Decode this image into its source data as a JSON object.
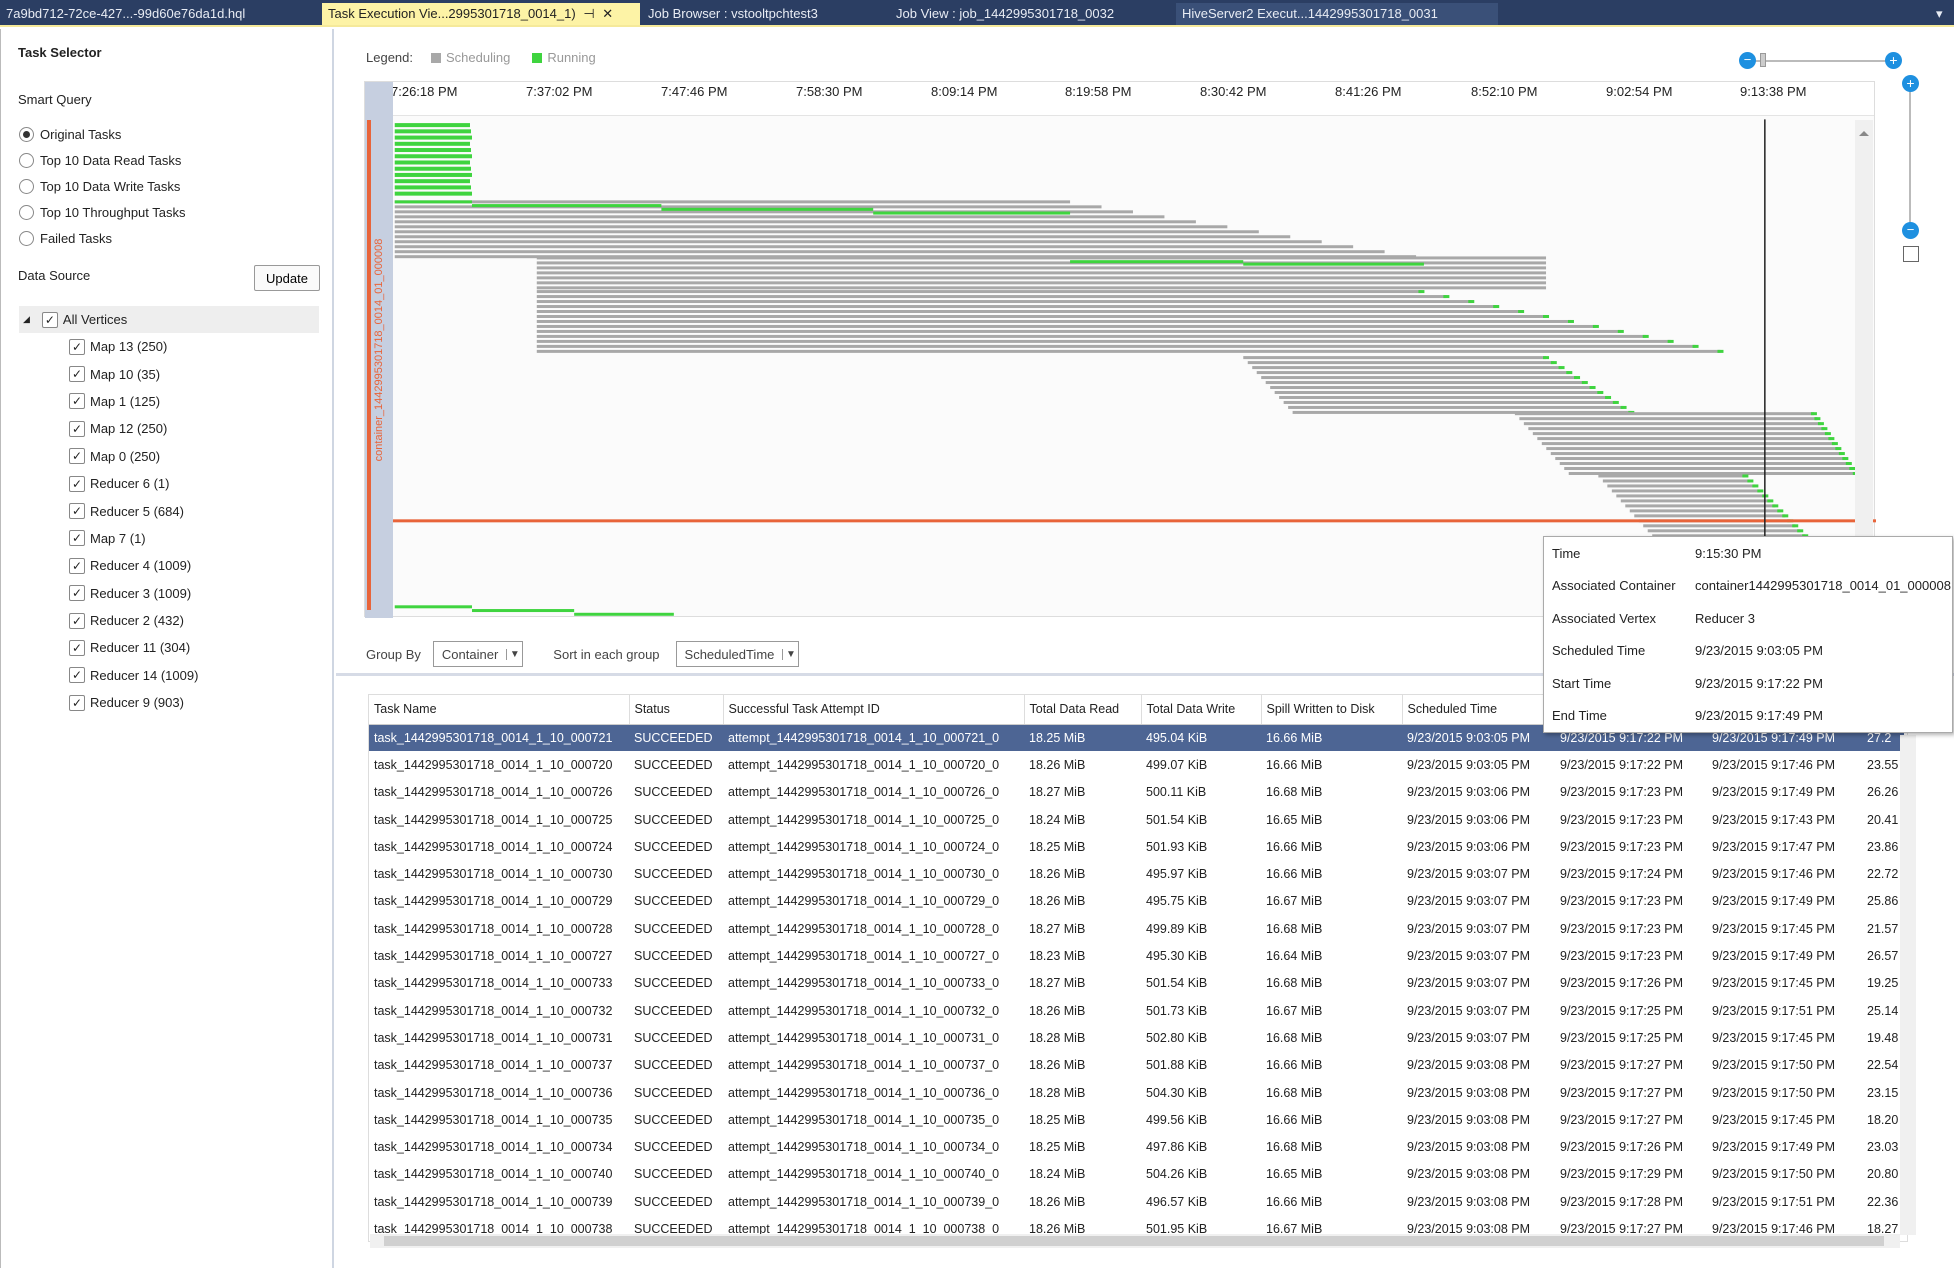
{
  "tabs": [
    {
      "label": "7a9bd712-72ce-427...-99d60e76da1d.hql",
      "active": false
    },
    {
      "label": "Task Execution Vie...2995301718_0014_1)",
      "active": true
    },
    {
      "label": "Job Browser : vstooltpchtest3",
      "active": false
    },
    {
      "label": "Job View : job_1442995301718_0032",
      "active": false
    },
    {
      "label": "HiveServer2 Execut...1442995301718_0031",
      "active": false
    }
  ],
  "tab_controls": {
    "pin": "⊣",
    "close": "✕",
    "overflow": "▾"
  },
  "task_selector": {
    "title": "Task Selector",
    "smart_query_label": "Smart Query",
    "options": [
      "Original Tasks",
      "Top 10 Data Read Tasks",
      "Top 10 Data Write Tasks",
      "Top 10  Throughput Tasks",
      "Failed Tasks"
    ],
    "selected_option": 0,
    "data_source_label": "Data Source",
    "update_button": "Update",
    "root": {
      "label": "All Vertices",
      "checked": true
    },
    "vertices": [
      {
        "label": "Map 13 (250)",
        "checked": true
      },
      {
        "label": "Map 10 (35)",
        "checked": true
      },
      {
        "label": "Map 1 (125)",
        "checked": true
      },
      {
        "label": "Map 12 (250)",
        "checked": true
      },
      {
        "label": "Map 0 (250)",
        "checked": true
      },
      {
        "label": "Reducer 6 (1)",
        "checked": true
      },
      {
        "label": "Reducer 5 (684)",
        "checked": true
      },
      {
        "label": "Map 7 (1)",
        "checked": true
      },
      {
        "label": "Reducer 4 (1009)",
        "checked": true
      },
      {
        "label": "Reducer 3 (1009)",
        "checked": true
      },
      {
        "label": "Reducer 2 (432)",
        "checked": true
      },
      {
        "label": "Reducer 11 (304)",
        "checked": true
      },
      {
        "label": "Reducer 14 (1009)",
        "checked": true
      },
      {
        "label": "Reducer 9 (903)",
        "checked": true
      }
    ]
  },
  "legend": {
    "label": "Legend:",
    "items": [
      {
        "label": "Scheduling",
        "color": "#a8a8a8"
      },
      {
        "label": "Running",
        "color": "#3fd43f"
      }
    ]
  },
  "timeline": {
    "ticks": [
      "7:26:18 PM",
      "7:37:02 PM",
      "7:47:46 PM",
      "7:58:30 PM",
      "8:09:14 PM",
      "8:19:58 PM",
      "8:30:42 PM",
      "8:41:26 PM",
      "8:52:10 PM",
      "9:02:54 PM",
      "9:13:38 PM"
    ],
    "container_label": "container_1442995301718_0014_01_000008",
    "colors": {
      "scheduling": "#a8a8a8",
      "running": "#3fd43f",
      "container_line": "#e8643a",
      "accent": "#1e90e0"
    }
  },
  "tooltip": {
    "rows": [
      {
        "key": "Time",
        "value": "9:15:30 PM"
      },
      {
        "key": "Associated Container",
        "value": "container1442995301718_0014_01_000008"
      },
      {
        "key": "Associated Vertex",
        "value": "Reducer 3"
      },
      {
        "key": "Scheduled Time",
        "value": "9/23/2015 9:03:05 PM"
      },
      {
        "key": "Start Time",
        "value": "9/23/2015 9:17:22 PM"
      },
      {
        "key": "End Time",
        "value": "9/23/2015 9:17:49 PM"
      }
    ]
  },
  "controls": {
    "group_by_label": "Group By",
    "group_by_value": "Container",
    "sort_label": "Sort in each group",
    "sort_value": "ScheduledTime"
  },
  "table": {
    "columns": [
      "Task Name",
      "Status",
      "Successful Task Attempt ID",
      "Total Data Read",
      "Total Data Write",
      "Spill Written to Disk",
      "Scheduled Time",
      "",
      "",
      ""
    ],
    "selected_row": 0,
    "rows": [
      [
        "task_1442995301718_0014_1_10_000721",
        "SUCCEEDED",
        "attempt_1442995301718_0014_1_10_000721_0",
        "18.25 MiB",
        "495.04 KiB",
        "16.66 MiB",
        "9/23/2015 9:03:05 PM",
        "9/23/2015 9:17:22 PM",
        "9/23/2015 9:17:49 PM",
        "27.2"
      ],
      [
        "task_1442995301718_0014_1_10_000720",
        "SUCCEEDED",
        "attempt_1442995301718_0014_1_10_000720_0",
        "18.26 MiB",
        "499.07 KiB",
        "16.66 MiB",
        "9/23/2015 9:03:05 PM",
        "9/23/2015 9:17:22 PM",
        "9/23/2015 9:17:46 PM",
        "23.55"
      ],
      [
        "task_1442995301718_0014_1_10_000726",
        "SUCCEEDED",
        "attempt_1442995301718_0014_1_10_000726_0",
        "18.27 MiB",
        "500.11 KiB",
        "16.68 MiB",
        "9/23/2015 9:03:06 PM",
        "9/23/2015 9:17:23 PM",
        "9/23/2015 9:17:49 PM",
        "26.26"
      ],
      [
        "task_1442995301718_0014_1_10_000725",
        "SUCCEEDED",
        "attempt_1442995301718_0014_1_10_000725_0",
        "18.24 MiB",
        "501.54 KiB",
        "16.65 MiB",
        "9/23/2015 9:03:06 PM",
        "9/23/2015 9:17:23 PM",
        "9/23/2015 9:17:43 PM",
        "20.41"
      ],
      [
        "task_1442995301718_0014_1_10_000724",
        "SUCCEEDED",
        "attempt_1442995301718_0014_1_10_000724_0",
        "18.25 MiB",
        "501.93 KiB",
        "16.66 MiB",
        "9/23/2015 9:03:06 PM",
        "9/23/2015 9:17:23 PM",
        "9/23/2015 9:17:47 PM",
        "23.86"
      ],
      [
        "task_1442995301718_0014_1_10_000730",
        "SUCCEEDED",
        "attempt_1442995301718_0014_1_10_000730_0",
        "18.26 MiB",
        "495.97 KiB",
        "16.66 MiB",
        "9/23/2015 9:03:07 PM",
        "9/23/2015 9:17:24 PM",
        "9/23/2015 9:17:46 PM",
        "22.72"
      ],
      [
        "task_1442995301718_0014_1_10_000729",
        "SUCCEEDED",
        "attempt_1442995301718_0014_1_10_000729_0",
        "18.26 MiB",
        "495.75 KiB",
        "16.67 MiB",
        "9/23/2015 9:03:07 PM",
        "9/23/2015 9:17:23 PM",
        "9/23/2015 9:17:49 PM",
        "25.86"
      ],
      [
        "task_1442995301718_0014_1_10_000728",
        "SUCCEEDED",
        "attempt_1442995301718_0014_1_10_000728_0",
        "18.27 MiB",
        "499.89 KiB",
        "16.68 MiB",
        "9/23/2015 9:03:07 PM",
        "9/23/2015 9:17:23 PM",
        "9/23/2015 9:17:45 PM",
        "21.57"
      ],
      [
        "task_1442995301718_0014_1_10_000727",
        "SUCCEEDED",
        "attempt_1442995301718_0014_1_10_000727_0",
        "18.23 MiB",
        "495.30 KiB",
        "16.64 MiB",
        "9/23/2015 9:03:07 PM",
        "9/23/2015 9:17:23 PM",
        "9/23/2015 9:17:49 PM",
        "26.57"
      ],
      [
        "task_1442995301718_0014_1_10_000733",
        "SUCCEEDED",
        "attempt_1442995301718_0014_1_10_000733_0",
        "18.27 MiB",
        "501.54 KiB",
        "16.68 MiB",
        "9/23/2015 9:03:07 PM",
        "9/23/2015 9:17:26 PM",
        "9/23/2015 9:17:45 PM",
        "19.25"
      ],
      [
        "task_1442995301718_0014_1_10_000732",
        "SUCCEEDED",
        "attempt_1442995301718_0014_1_10_000732_0",
        "18.26 MiB",
        "501.73 KiB",
        "16.67 MiB",
        "9/23/2015 9:03:07 PM",
        "9/23/2015 9:17:25 PM",
        "9/23/2015 9:17:51 PM",
        "25.14"
      ],
      [
        "task_1442995301718_0014_1_10_000731",
        "SUCCEEDED",
        "attempt_1442995301718_0014_1_10_000731_0",
        "18.28 MiB",
        "502.80 KiB",
        "16.68 MiB",
        "9/23/2015 9:03:07 PM",
        "9/23/2015 9:17:25 PM",
        "9/23/2015 9:17:45 PM",
        "19.48"
      ],
      [
        "task_1442995301718_0014_1_10_000737",
        "SUCCEEDED",
        "attempt_1442995301718_0014_1_10_000737_0",
        "18.26 MiB",
        "501.88 KiB",
        "16.66 MiB",
        "9/23/2015 9:03:08 PM",
        "9/23/2015 9:17:27 PM",
        "9/23/2015 9:17:50 PM",
        "22.54"
      ],
      [
        "task_1442995301718_0014_1_10_000736",
        "SUCCEEDED",
        "attempt_1442995301718_0014_1_10_000736_0",
        "18.28 MiB",
        "504.30 KiB",
        "16.68 MiB",
        "9/23/2015 9:03:08 PM",
        "9/23/2015 9:17:27 PM",
        "9/23/2015 9:17:50 PM",
        "23.15"
      ],
      [
        "task_1442995301718_0014_1_10_000735",
        "SUCCEEDED",
        "attempt_1442995301718_0014_1_10_000735_0",
        "18.25 MiB",
        "499.56 KiB",
        "16.66 MiB",
        "9/23/2015 9:03:08 PM",
        "9/23/2015 9:17:27 PM",
        "9/23/2015 9:17:45 PM",
        "18.20"
      ],
      [
        "task_1442995301718_0014_1_10_000734",
        "SUCCEEDED",
        "attempt_1442995301718_0014_1_10_000734_0",
        "18.25 MiB",
        "497.86 KiB",
        "16.68 MiB",
        "9/23/2015 9:03:08 PM",
        "9/23/2015 9:17:26 PM",
        "9/23/2015 9:17:49 PM",
        "23.03"
      ],
      [
        "task_1442995301718_0014_1_10_000740",
        "SUCCEEDED",
        "attempt_1442995301718_0014_1_10_000740_0",
        "18.24 MiB",
        "504.26 KiB",
        "16.65 MiB",
        "9/23/2015 9:03:08 PM",
        "9/23/2015 9:17:29 PM",
        "9/23/2015 9:17:50 PM",
        "20.80"
      ],
      [
        "task_1442995301718_0014_1_10_000739",
        "SUCCEEDED",
        "attempt_1442995301718_0014_1_10_000739_0",
        "18.26 MiB",
        "496.57 KiB",
        "16.66 MiB",
        "9/23/2015 9:03:08 PM",
        "9/23/2015 9:17:28 PM",
        "9/23/2015 9:17:51 PM",
        "22.36"
      ],
      [
        "task_1442995301718_0014_1_10_000738",
        "SUCCEEDED",
        "attempt_1442995301718_0014_1_10_000738_0",
        "18.26 MiB",
        "501.95 KiB",
        "16.67 MiB",
        "9/23/2015 9:03:08 PM",
        "9/23/2015 9:17:27 PM",
        "9/23/2015 9:17:46 PM",
        "18.27"
      ]
    ]
  }
}
